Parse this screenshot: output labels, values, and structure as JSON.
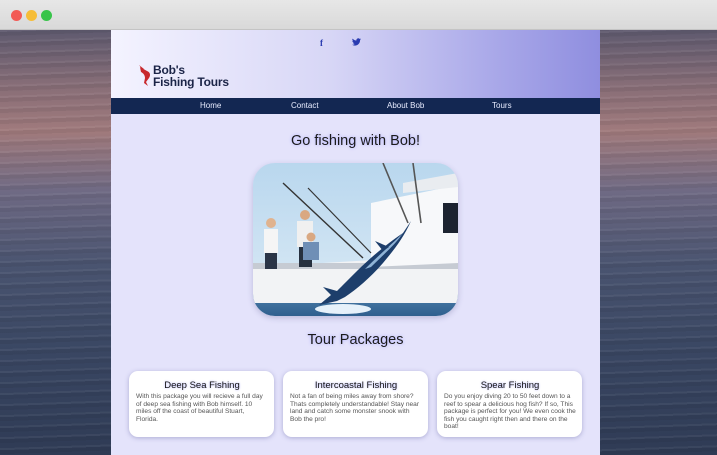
{
  "window": {
    "controls": [
      "close",
      "minimize",
      "maximize"
    ]
  },
  "header": {
    "social": {
      "facebook": "f",
      "twitter_icon": "twitter-bird-icon"
    },
    "logo_line1": "Bob's",
    "logo_line2": "Fishing Tours"
  },
  "nav": {
    "items": [
      {
        "label": "Home"
      },
      {
        "label": "Contact"
      },
      {
        "label": "About Bob"
      },
      {
        "label": "Tours"
      }
    ]
  },
  "main": {
    "hero_title": "Go fishing with Bob!",
    "packages_title": "Tour Packages",
    "packages": [
      {
        "title": "Deep Sea Fishing",
        "text": "With this package you will recieve a full day of deep sea fishing with Bob himself. 10 miles off the coast of beautiful Stuart, Florida."
      },
      {
        "title": "Intercoastal Fishing",
        "text": "Not a fan of being miles away from shore? Thats completely understandable! Stay near land and catch some monster snook with Bob the pro!"
      },
      {
        "title": "Spear Fishing",
        "text": "Do you enjoy diving 20 to 50 feet down to a reef to spear a delicious hog fish? If so, This package is perfect for you! We even cook the fish you caught right then and there on the boat!"
      }
    ]
  },
  "colors": {
    "nav_bg": "#132752",
    "site_bg": "#e4e3fb",
    "header_gradient_end": "#8f8edf",
    "accent_red": "#c8282d"
  }
}
